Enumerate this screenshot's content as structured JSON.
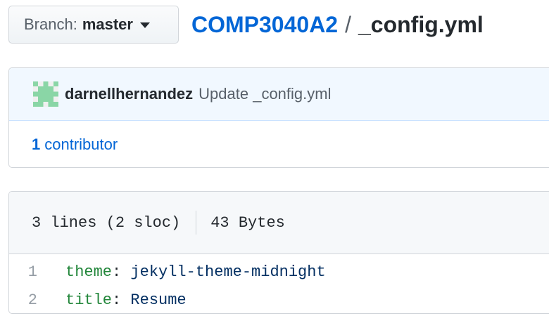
{
  "branch": {
    "prefix": "Branch:",
    "name": "master"
  },
  "breadcrumb": {
    "repo": "COMP3040A2",
    "separator": "/",
    "file": "_config.yml"
  },
  "commit": {
    "author": "darnellhernandez",
    "message": "Update _config.yml",
    "avatar_color": "#8ad6a6"
  },
  "contributors": {
    "count": "1",
    "label": "contributor"
  },
  "file_info": {
    "lines": "3 lines (2 sloc)",
    "size": "43 Bytes"
  },
  "code_lines": [
    {
      "number": "1",
      "key": "theme",
      "colon": ":",
      "value": "jekyll-theme-midnight"
    },
    {
      "number": "2",
      "key": "title",
      "colon": ":",
      "value": "Resume"
    }
  ]
}
